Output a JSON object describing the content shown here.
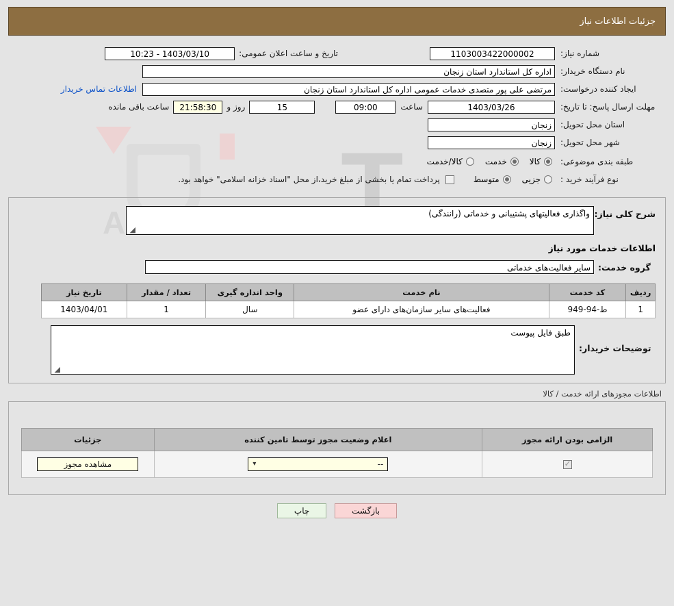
{
  "header": {
    "title": "جزئیات اطلاعات نیاز"
  },
  "summary": {
    "need_number_label": "شماره نیاز:",
    "need_number_value": "1103003422000002",
    "announce_label": "تاریخ و ساعت اعلان عمومی:",
    "announce_value": "1403/03/10 - 10:23",
    "buyer_org_label": "نام دستگاه خریدار:",
    "buyer_org_value": "اداره کل استاندارد استان زنجان",
    "creator_label": "ایجاد کننده درخواست:",
    "creator_value": "مرتضی علی پور متصدی خدمات عمومی اداره کل استاندارد استان زنجان",
    "contact_link": "اطلاعات تماس خریدار",
    "deadline_label": "مهلت ارسال پاسخ: تا تاریخ:",
    "deadline_date": "1403/03/26",
    "time_label": "ساعت",
    "deadline_time": "09:00",
    "days_value": "15",
    "days_label": "روز و",
    "countdown_value": "21:58:30",
    "remaining_label": "ساعت باقی مانده",
    "province_label": "استان محل تحویل:",
    "province_value": "زنجان",
    "city_label": "شهر محل تحویل:",
    "city_value": "زنجان",
    "category_label": "طبقه بندی موضوعی:",
    "category_options": [
      {
        "label": "کالا",
        "selected": false
      },
      {
        "label": "خدمت",
        "selected": true
      },
      {
        "label": "کالا/خدمت",
        "selected": false
      }
    ],
    "process_label": "نوع فرآیند خرید :",
    "process_options": [
      {
        "label": "جزیی",
        "selected": false
      },
      {
        "label": "متوسط",
        "selected": true
      }
    ],
    "treasury_checkbox_checked": false,
    "treasury_text": "پرداخت تمام یا بخشی از مبلغ خرید،از محل \"اسناد خزانه اسلامی\" خواهد بود."
  },
  "details": {
    "need_desc_label": "شرح کلی نیاز:",
    "need_desc_value": "واگذاری فعالیتهای پشتیبانی و خدماتی (رانندگی)",
    "services_heading": "اطلاعات خدمات مورد نیاز",
    "service_group_label": "گروه خدمت:",
    "service_group_value": "سایر فعالیت‌های خدماتی",
    "table": {
      "columns": [
        "ردیف",
        "کد خدمت",
        "نام خدمت",
        "واحد اندازه گیری",
        "تعداد / مقدار",
        "تاریخ نیاز"
      ],
      "rows": [
        [
          "1",
          "ط-94-949",
          "فعالیت‌های سایر سازمان‌های دارای عضو",
          "سال",
          "1",
          "1403/04/01"
        ]
      ]
    },
    "buyer_notes_label": "توضیحات خریدار:",
    "buyer_notes_value": "طبق فایل پیوست"
  },
  "permits": {
    "section_title": "اطلاعات مجوزهای ارائه خدمت / کالا",
    "columns": [
      "الزامی بودن ارائه مجوز",
      "اعلام وضعیت مجوز توسط تامین کننده",
      "جزئیات"
    ],
    "rows": [
      {
        "required_checked": true,
        "status_value": "--",
        "details_button": "مشاهده مجوز"
      }
    ]
  },
  "footer": {
    "print_label": "چاپ",
    "back_label": "بازگشت"
  },
  "watermark": {
    "text_left": "An",
    "text_mid": "a",
    "text_right": "Tender.net"
  },
  "colors": {
    "header_bg": "#8d6e41",
    "page_bg": "#e4e4e4",
    "link": "#0a50c8",
    "cream": "#ffffe4",
    "table_header": "#c0c0c0",
    "print_btn": "#eaf6e6",
    "back_btn": "#fad6d6"
  }
}
